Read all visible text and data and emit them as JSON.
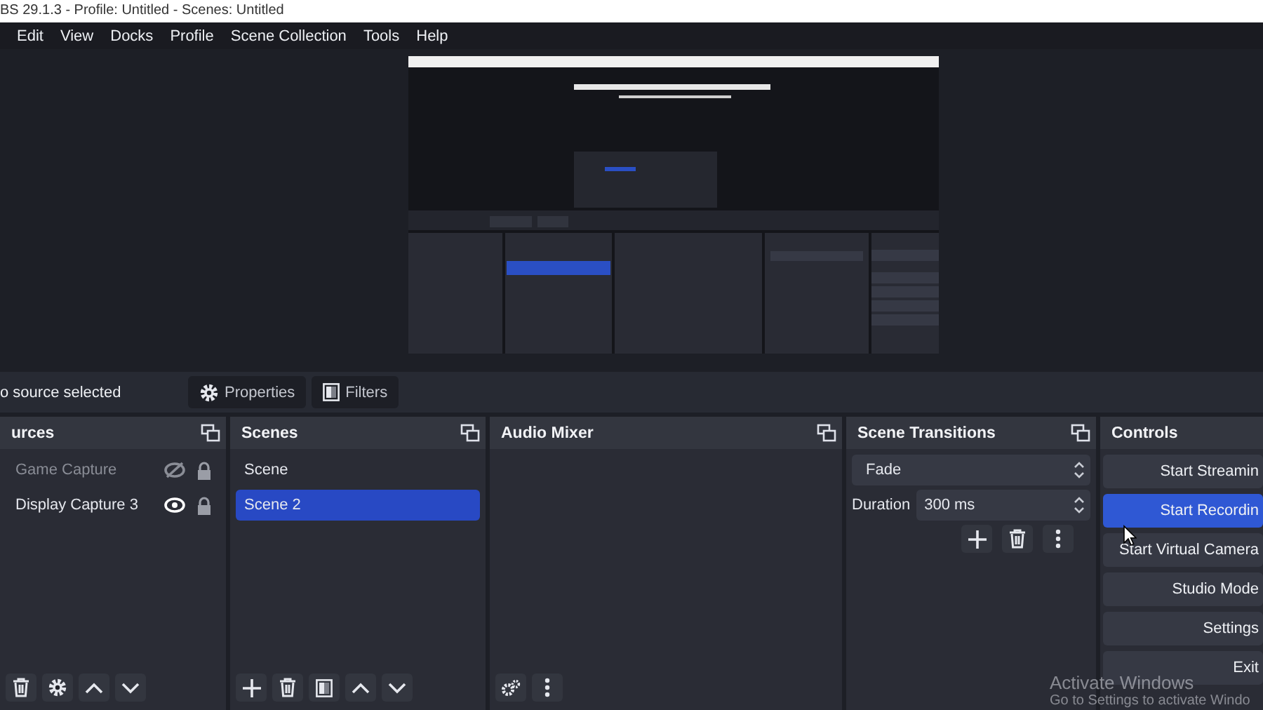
{
  "window": {
    "title": "BS 29.1.3 - Profile: Untitled - Scenes: Untitled"
  },
  "menu": [
    "Edit",
    "View",
    "Docks",
    "Profile",
    "Scene Collection",
    "Tools",
    "Help"
  ],
  "context_bar": {
    "status": "o source selected",
    "buttons": [
      {
        "kind": "properties",
        "label": "Properties"
      },
      {
        "kind": "filters",
        "label": "Filters"
      }
    ]
  },
  "docks": {
    "sources": {
      "title": "urces",
      "items": [
        {
          "name": "Game Capture",
          "visible": false,
          "locked": true
        },
        {
          "name": "Display Capture 3",
          "visible": true,
          "locked": true
        }
      ]
    },
    "scenes": {
      "title": "Scenes",
      "items": [
        {
          "name": "Scene",
          "selected": false
        },
        {
          "name": "Scene 2",
          "selected": true
        }
      ]
    },
    "audio_mixer": {
      "title": "Audio Mixer"
    },
    "scene_transitions": {
      "title": "Scene Transitions",
      "transition": "Fade",
      "duration_label": "Duration",
      "duration": "300 ms"
    },
    "controls": {
      "title": "Controls",
      "buttons": [
        {
          "label": "Start Streamin",
          "hovered": false
        },
        {
          "label": "Start Recordin",
          "hovered": true
        },
        {
          "label": "Start Virtual Camera",
          "hovered": false
        },
        {
          "label": "Studio Mode",
          "hovered": false
        },
        {
          "label": "Settings",
          "hovered": false
        },
        {
          "label": "Exit",
          "hovered": false
        }
      ]
    }
  },
  "watermark": {
    "line_1": "Activate Windows",
    "line_2": "Go to Settings to activate Windo"
  }
}
